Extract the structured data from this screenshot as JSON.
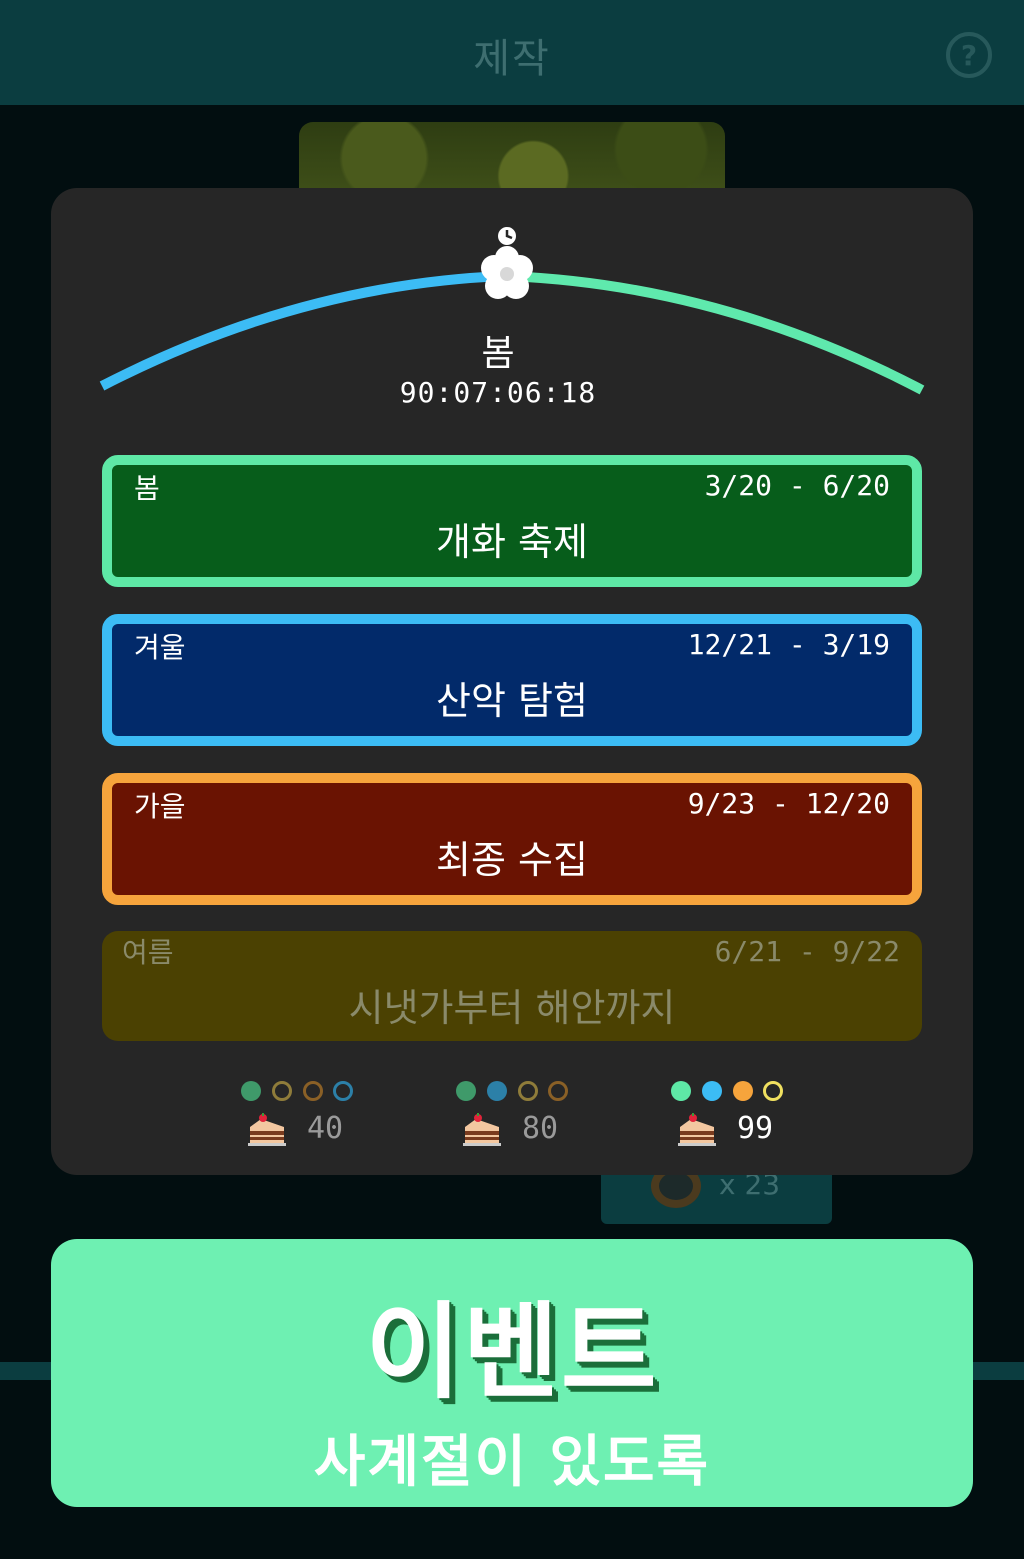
{
  "header": {
    "title": "제작",
    "help_icon": "question-circle-icon"
  },
  "background": {
    "reward_qty": "x 23"
  },
  "season_tracker": {
    "current_season": "봄",
    "countdown": "90:07:06:18",
    "icon": "flower-icon",
    "colors": {
      "left_arc": "#3cbcf5",
      "right_arc": "#5fe9ad"
    }
  },
  "events": [
    {
      "season": "봄",
      "dates": "3/20 - 6/20",
      "name": "개화 축제",
      "border": "#5ee8a6",
      "fill": "#075d1b",
      "active": true
    },
    {
      "season": "겨울",
      "dates": "12/21 - 3/19",
      "name": "산악 탐험",
      "border": "#3cbcf5",
      "fill": "#022a6a",
      "active": true
    },
    {
      "season": "가을",
      "dates": "9/23 - 12/20",
      "name": "최종 수집",
      "border": "#f6a43c",
      "fill": "#6a1302",
      "active": true
    },
    {
      "season": "여름",
      "dates": "6/21 - 9/22",
      "name": "시냇가부터 해안까지",
      "border": "#4b4102",
      "fill": "#4b4102",
      "active": false
    }
  ],
  "rewards": [
    {
      "count": "40",
      "icon": "cake-icon",
      "count_color": "#9a9a9a",
      "dots": [
        {
          "color": "#3f9a6a",
          "filled": true
        },
        {
          "color": "#8f7c3a",
          "filled": false
        },
        {
          "color": "#8a6026",
          "filled": false
        },
        {
          "color": "#2c80a8",
          "filled": false
        }
      ]
    },
    {
      "count": "80",
      "icon": "cake-icon",
      "count_color": "#9a9a9a",
      "dots": [
        {
          "color": "#3f9a6a",
          "filled": true
        },
        {
          "color": "#2c80a8",
          "filled": true
        },
        {
          "color": "#8f7c3a",
          "filled": false
        },
        {
          "color": "#8a6026",
          "filled": false
        }
      ]
    },
    {
      "count": "99",
      "icon": "cake-icon",
      "count_color": "#ffffff",
      "dots": [
        {
          "color": "#5ee8a6",
          "filled": true
        },
        {
          "color": "#3cbcf5",
          "filled": true
        },
        {
          "color": "#f6a43c",
          "filled": true
        },
        {
          "color": "#f0e060",
          "filled": false
        }
      ]
    }
  ],
  "banner": {
    "headline": "이벤트",
    "tagline": "사계절이 있도록",
    "bg": "#6ef0b2"
  }
}
